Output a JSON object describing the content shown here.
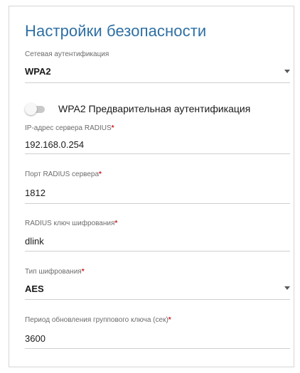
{
  "title": "Настройки безопасности",
  "network_auth": {
    "label": "Сетевая аутентификация",
    "value": "WPA2",
    "icon": "chevron-down-icon"
  },
  "preauth": {
    "label": "WPA2 Предварительная аутентификация",
    "enabled": false
  },
  "radius_ip": {
    "label": "IP-адрес сервера RADIUS",
    "required_mark": "*",
    "value": "192.168.0.254"
  },
  "radius_port": {
    "label": "Порт RADIUS сервера",
    "required_mark": "*",
    "value": "1812"
  },
  "radius_key": {
    "label": "RADIUS ключ шифрования",
    "required_mark": "*",
    "value": "dlink"
  },
  "encryption": {
    "label": "Тип шифрования",
    "required_mark": "*",
    "value": "AES",
    "icon": "chevron-down-icon"
  },
  "group_key_period": {
    "label": "Период обновления группового ключа (сек)",
    "required_mark": "*",
    "value": "3600"
  },
  "colors": {
    "title": "#2e6fa3",
    "required": "#d01e1e",
    "underline": "#cfcfcf"
  }
}
